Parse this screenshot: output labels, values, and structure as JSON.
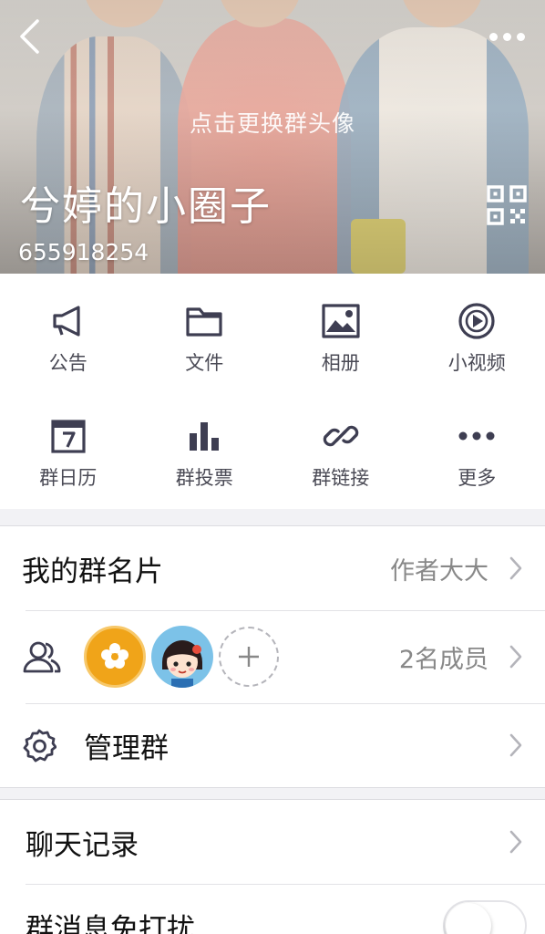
{
  "header": {
    "change_avatar_label": "点击更换群头像",
    "group_name": "兮婷的小圈子",
    "group_id": "655918254"
  },
  "features": [
    {
      "label": "公告",
      "icon": "megaphone-icon"
    },
    {
      "label": "文件",
      "icon": "folder-icon"
    },
    {
      "label": "相册",
      "icon": "photo-album-icon"
    },
    {
      "label": "小视频",
      "icon": "video-icon"
    },
    {
      "label": "群日历",
      "icon": "calendar-icon"
    },
    {
      "label": "群投票",
      "icon": "bar-chart-icon"
    },
    {
      "label": "群链接",
      "icon": "link-icon"
    },
    {
      "label": "更多",
      "icon": "more-dots-icon"
    }
  ],
  "rows": {
    "card": {
      "label": "我的群名片",
      "value": "作者大大"
    },
    "members": {
      "count": "2名成员"
    },
    "manage": {
      "label": "管理群"
    },
    "chat_history": {
      "label": "聊天记录"
    },
    "mute": {
      "label": "群消息免打扰",
      "enabled": false
    }
  },
  "colors": {
    "icon": "#3e3e52",
    "background": "#f2f2f5"
  }
}
